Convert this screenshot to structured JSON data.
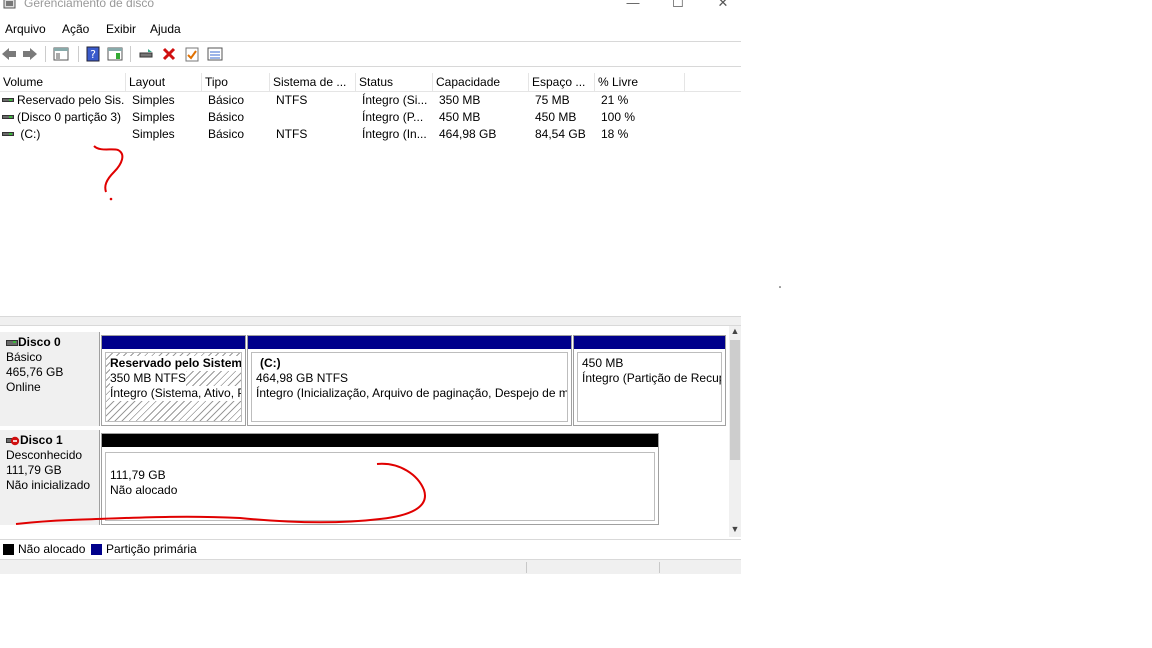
{
  "window": {
    "title": "Gerenciamento de disco",
    "minimize": "—",
    "maximize": "☐",
    "close": "✕"
  },
  "menu": [
    "Arquivo",
    "Ação",
    "Exibir",
    "Ajuda"
  ],
  "toolbar": {
    "icons": [
      "back-arrow-icon",
      "forward-arrow-icon",
      "console-tree-icon",
      "help-icon",
      "properties-icon",
      "connect-icon",
      "delete-icon",
      "check-icon",
      "list-view-icon"
    ]
  },
  "volumes": {
    "columns": [
      "Volume",
      "Layout",
      "Tipo",
      "Sistema de ...",
      "Status",
      "Capacidade",
      "Espaço ...",
      "% Livre"
    ],
    "rows": [
      [
        "Reservado pelo Sis...",
        "Simples",
        "Básico",
        "NTFS",
        "Íntegro (Si...",
        "350 MB",
        "75 MB",
        "21 %"
      ],
      [
        "(Disco 0 partição 3)",
        "Simples",
        "Básico",
        "",
        "Íntegro (P...",
        "450 MB",
        "450 MB",
        "100 %"
      ],
      [
        " (C:)",
        "Simples",
        "Básico",
        "NTFS",
        "Íntegro (In...",
        "464,98 GB",
        "84,54 GB",
        "18 %"
      ]
    ]
  },
  "disks": {
    "disk0": {
      "name": "Disco 0",
      "type": "Básico",
      "size": "465,76 GB",
      "state": "Online",
      "partitions": [
        {
          "title": "Reservado pelo Sistema",
          "size": "350 MB NTFS",
          "status": "Íntegro (Sistema, Ativo, P"
        },
        {
          "title": "(C:)",
          "size": "464,98 GB NTFS",
          "status": "Íntegro (Inicialização, Arquivo de paginação, Despejo de m"
        },
        {
          "title": "",
          "size": "450 MB",
          "status": "Íntegro (Partição de Recup"
        }
      ]
    },
    "disk1": {
      "name": "Disco 1",
      "type": "Desconhecido",
      "size": "111,79 GB",
      "state": "Não inicializado",
      "partitions": [
        {
          "size": "111,79 GB",
          "status": "Não alocado"
        }
      ]
    }
  },
  "legend": {
    "unallocated": "Não alocado",
    "primary": "Partição primária",
    "colors": {
      "unallocated": "#000000",
      "primary": "#00008b"
    }
  },
  "annotation": {
    "mark": "?",
    "color": "#e00000"
  }
}
